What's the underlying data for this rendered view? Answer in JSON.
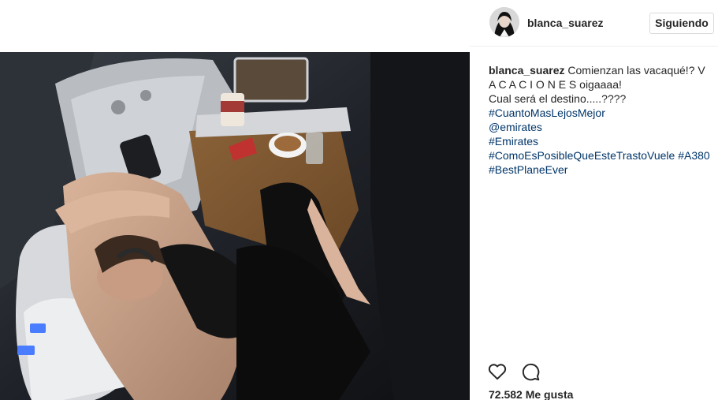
{
  "post": {
    "image_alt": "Woman resting in a first-class airplane seat",
    "author": {
      "username": "blanca_suarez",
      "follow_label": "Siguiendo"
    },
    "caption": {
      "author": "blanca_suarez",
      "line1": "Comienzan las vacaqué!? V",
      "line2": "A C A C I O N E S oigaaaa!",
      "line3": "Cual será el destino.....????",
      "tag1": "#CuantoMasLejosMejor",
      "mention": "@emirates",
      "tag2": "#Emirates",
      "tag3": "#ComoEsPosibleQueEsteTrastoVuele",
      "tag4": "#A380",
      "tag5": "#BestPlaneEver"
    },
    "actions": {
      "like_icon": "heart-icon",
      "comment_icon": "comment-icon"
    },
    "likes": "72.582 Me gusta"
  },
  "colors": {
    "link": "#003569",
    "text": "#262626",
    "border": "#dbdbdb"
  }
}
